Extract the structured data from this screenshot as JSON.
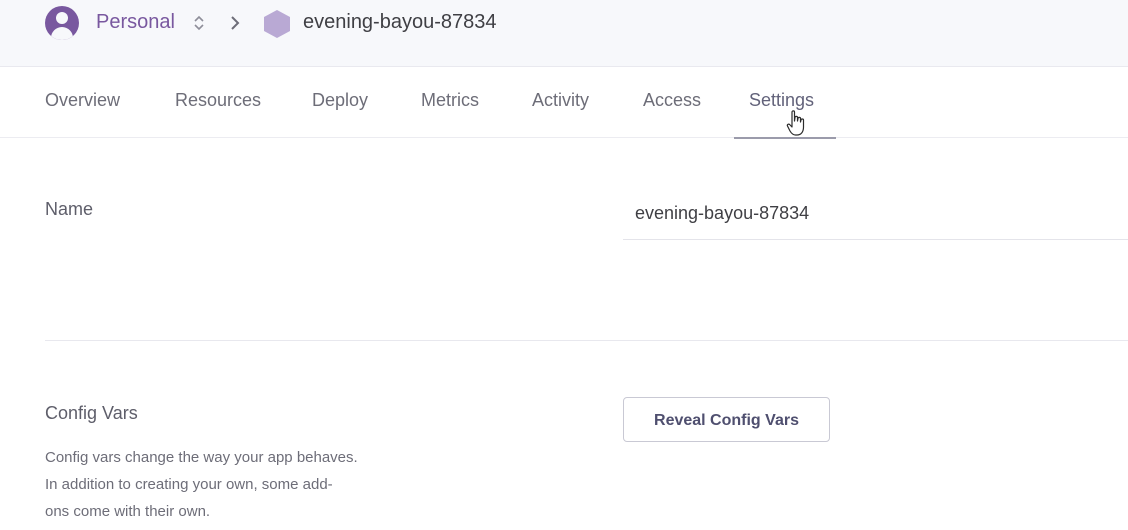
{
  "header": {
    "account": "Personal",
    "app_name": "evening-bayou-87834",
    "icons": [
      "user-avatar-icon",
      "updown-icon",
      "chevron-right-icon",
      "hexagon-app-icon"
    ]
  },
  "tabs": [
    "Overview",
    "Resources",
    "Deploy",
    "Metrics",
    "Activity",
    "Access",
    "Settings"
  ],
  "active_tab": "Settings",
  "settings": {
    "name_label": "Name",
    "name_value": "evening-bayou-87834",
    "config_vars_title": "Config Vars",
    "config_vars_description": "Config vars change the way your app behaves. In addition to creating your own, some add-ons come with their own.",
    "config_vars_description_lines": [
      "Config vars change the way your app behaves.",
      "In addition to creating your own, some add-",
      "ons come with their own."
    ],
    "reveal_button": "Reveal Config Vars"
  },
  "colors": {
    "accent_purple": "#79589f",
    "hexagon": "#b9a9d4",
    "text_dark": "#3f3f44",
    "text_muted": "#6d6d78"
  }
}
